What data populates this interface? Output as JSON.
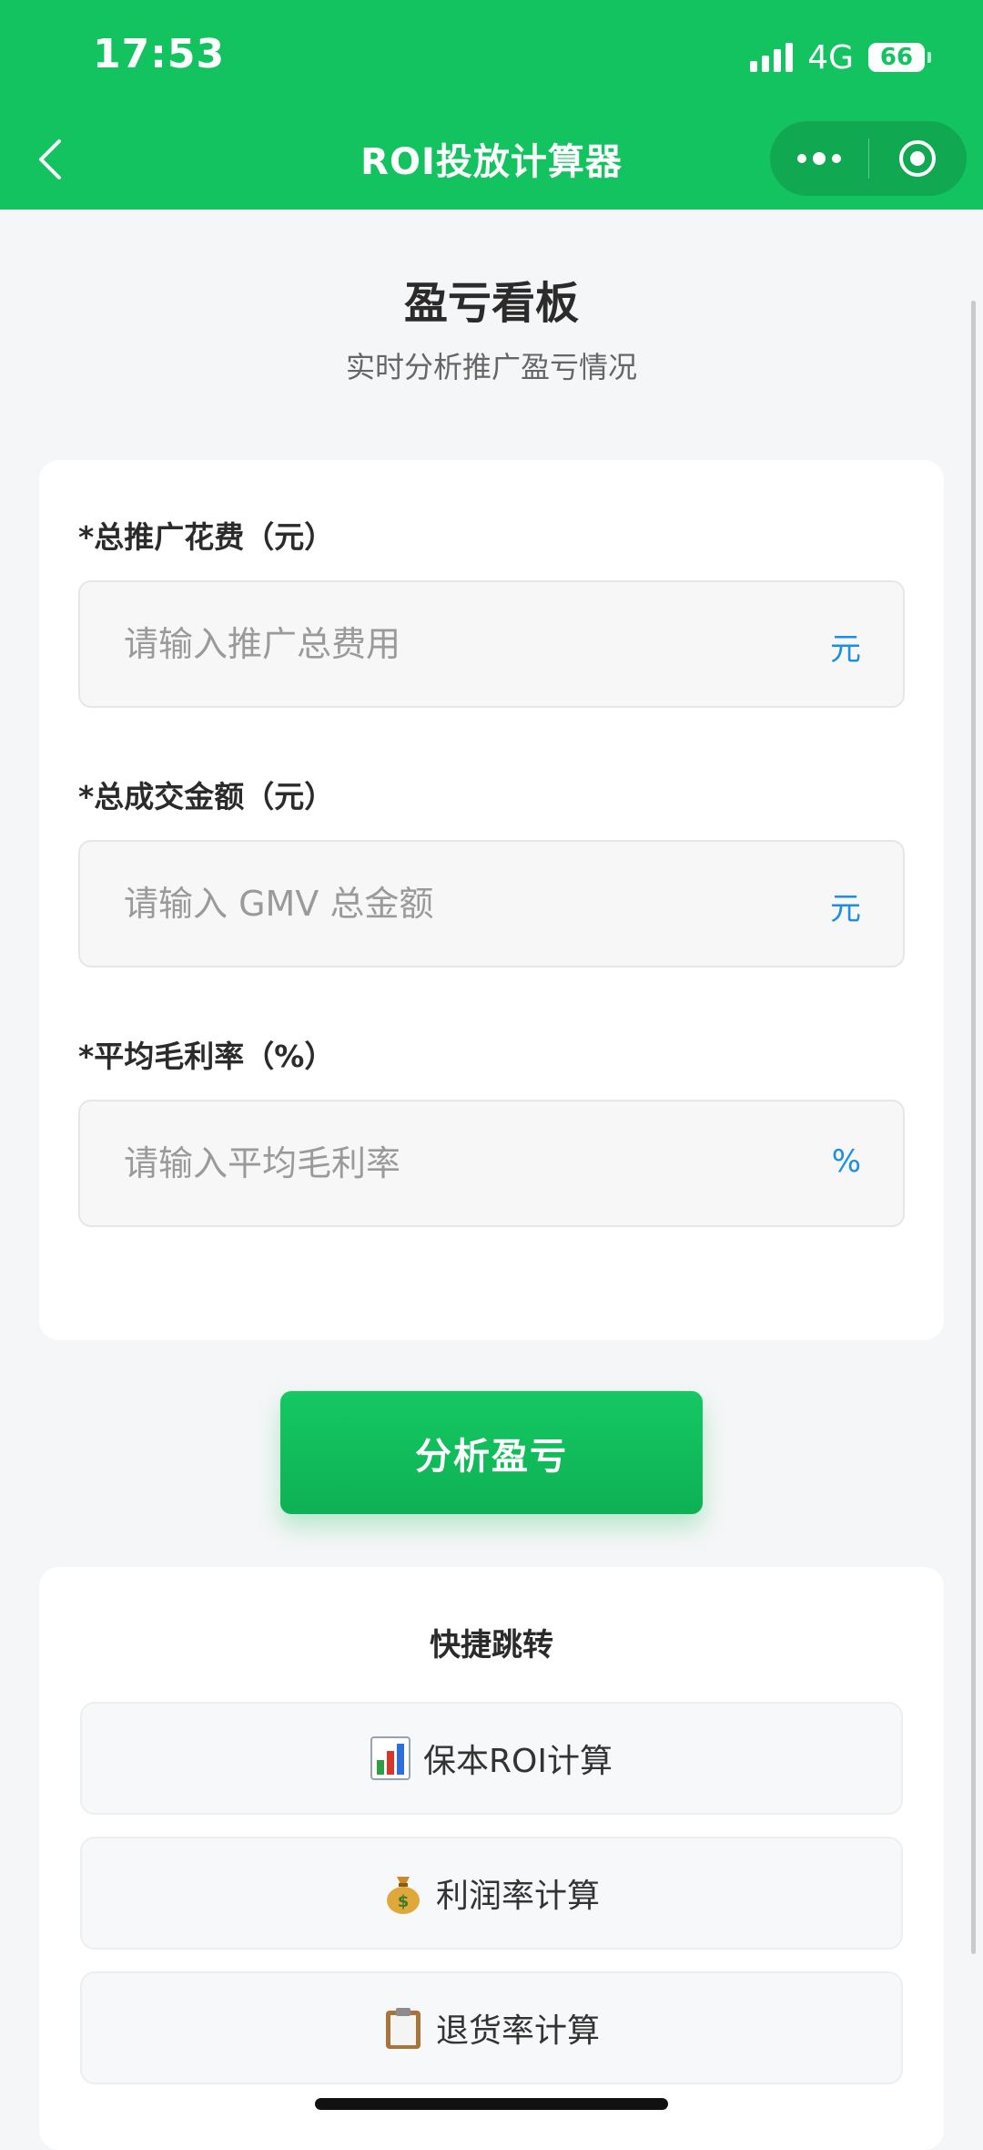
{
  "status_bar": {
    "time": "17:53",
    "network": "4G",
    "battery": "66"
  },
  "nav": {
    "title": "ROI投放计算器"
  },
  "header": {
    "title": "盈亏看板",
    "subtitle": "实时分析推广盈亏情况"
  },
  "form": {
    "fields": [
      {
        "label": "*总推广花费（元）",
        "placeholder": "请输入推广总费用",
        "value": "",
        "unit": "元"
      },
      {
        "label": "*总成交金额（元）",
        "placeholder": "请输入 GMV 总金额",
        "value": "",
        "unit": "元"
      },
      {
        "label": "*平均毛利率（%）",
        "placeholder": "请输入平均毛利率",
        "value": "",
        "unit": "%"
      }
    ]
  },
  "analyze_button": {
    "label": "分析盈亏"
  },
  "quick_links": {
    "title": "快捷跳转",
    "items": [
      {
        "label": "保本ROI计算",
        "icon": "bar-chart-icon"
      },
      {
        "label": "利润率计算",
        "icon": "money-bag-icon"
      },
      {
        "label": "退货率计算",
        "icon": "clipboard-icon"
      }
    ]
  },
  "colors": {
    "brand": "#13c35f",
    "unit": "#1a8fe3",
    "page_bg": "#f5f6f7"
  }
}
